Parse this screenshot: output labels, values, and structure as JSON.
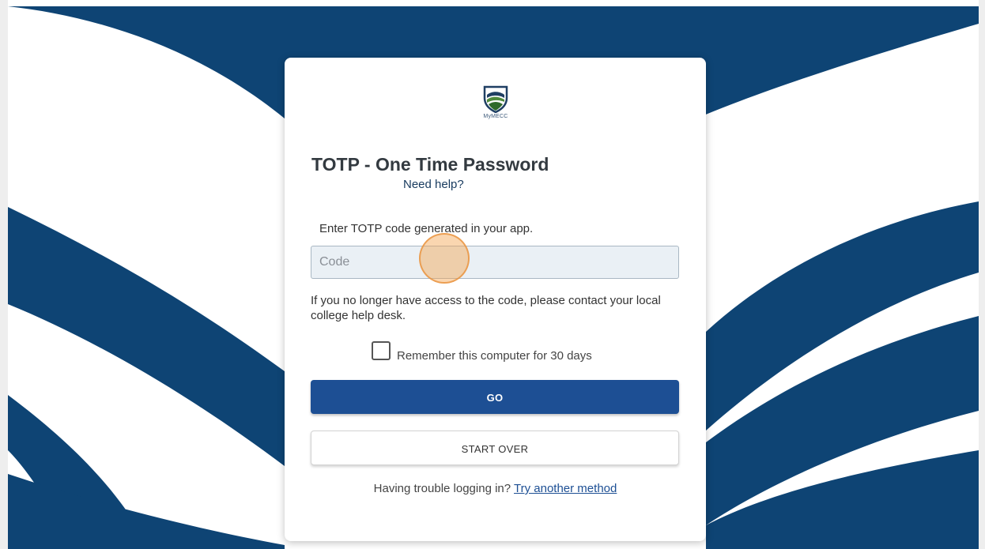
{
  "brand": {
    "logo_icon": "shield-landscape-icon",
    "logo_text": "MyMECC",
    "primary_color": "#1d4f94",
    "background_color": "#0e4474"
  },
  "card": {
    "title": "TOTP - One Time Password",
    "help_link": "Need help?",
    "instruction": "Enter TOTP code generated in your app.",
    "code_input": {
      "value": "",
      "placeholder": "Code"
    },
    "access_note": "If you no longer have access to the code, please contact your local college help desk.",
    "remember": {
      "label": "Remember this computer for 30 days",
      "checked": false
    },
    "go_button": "GO",
    "start_over_button": "START OVER",
    "trouble_text": "Having trouble logging in?",
    "trouble_link": "Try another method"
  }
}
